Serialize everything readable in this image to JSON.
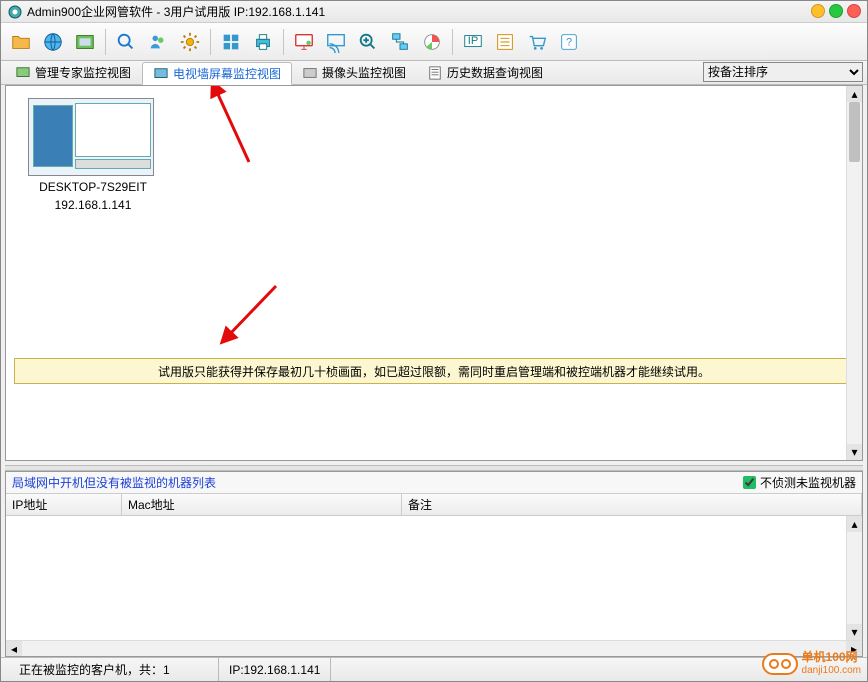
{
  "window": {
    "title": "Admin900企业网管软件 - 3用户试用版 IP:192.168.1.141"
  },
  "tabs": [
    {
      "label": "管理专家监控视图"
    },
    {
      "label": "电视墙屏幕监控视图"
    },
    {
      "label": "摄像头监控视图"
    },
    {
      "label": "历史数据查询视图"
    }
  ],
  "sort": {
    "selected": "按备注排序"
  },
  "thumbnail": {
    "name": "DESKTOP-7S29EIT",
    "ip": "192.168.1.141"
  },
  "notice": "试用版只能获得并保存最初几十桢画面，如已超过限额，需同时重启管理端和被控端机器才能继续试用。",
  "lower": {
    "title": "局域网中开机但没有被监视的机器列表",
    "checkbox": "不侦测未监视机器",
    "columns": [
      "IP地址",
      "Mac地址",
      "备注"
    ]
  },
  "status": {
    "left": "正在被监控的客户机，共：1",
    "ip": "IP:192.168.1.141"
  },
  "watermark": {
    "line1": "单机100网",
    "line2": "danji100.com"
  }
}
